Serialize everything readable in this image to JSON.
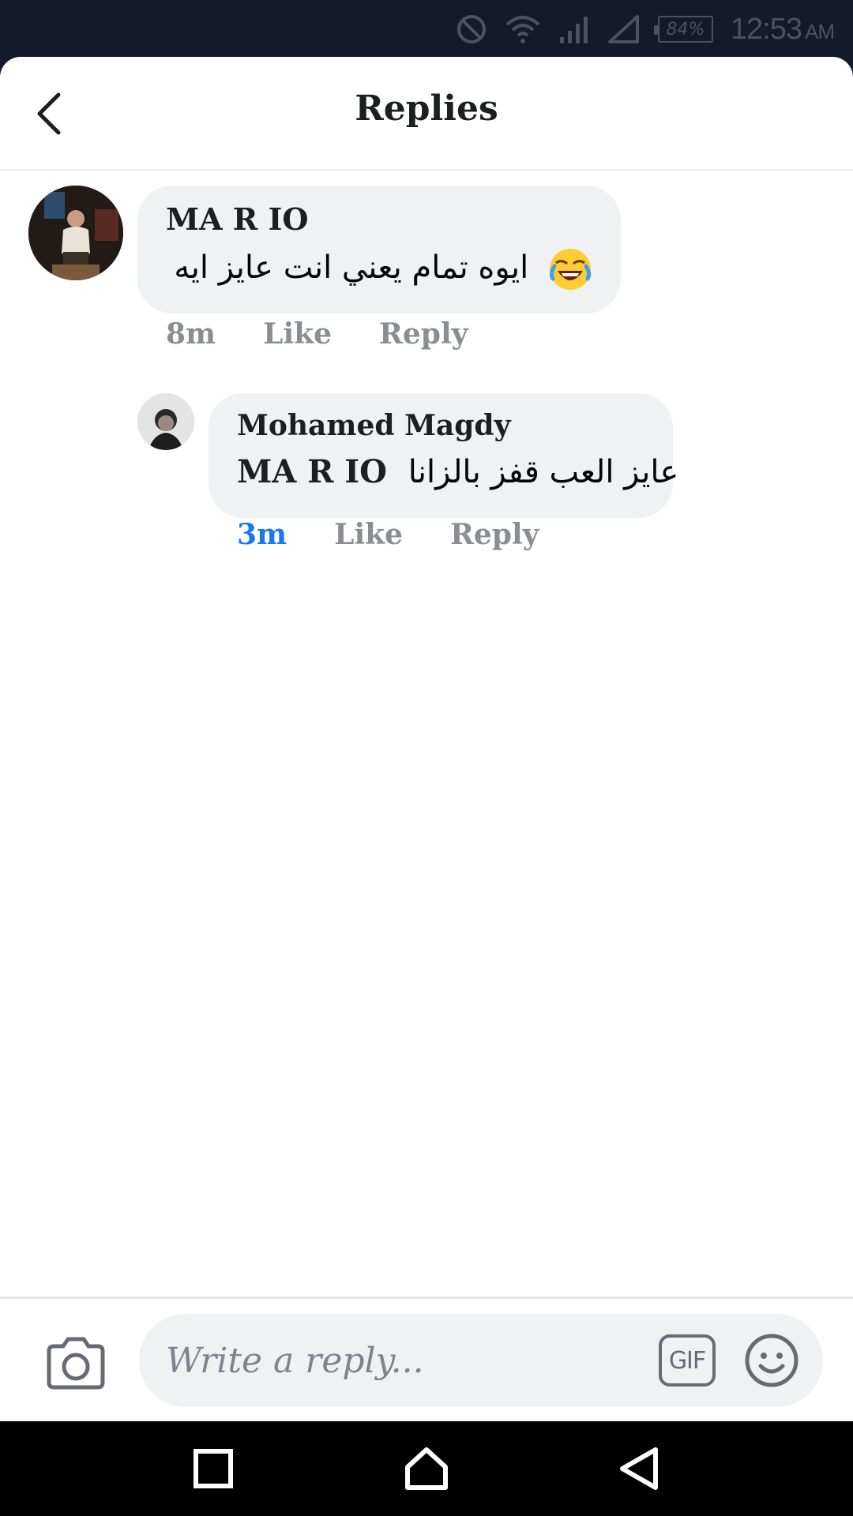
{
  "status_bar": {
    "battery": "84%",
    "time": "12:53",
    "ampm": "AM"
  },
  "header": {
    "title": "Replies"
  },
  "comments": [
    {
      "author": "MA R IO",
      "text": "ايوه تمام يعني انت عايز ايه",
      "emoji": "face-with-tears-of-joy",
      "time": "8m",
      "like": "Like",
      "reply": "Reply"
    },
    {
      "author": "Mohamed Magdy",
      "mention": "MA R IO",
      "text": "عايز العب قفز بالزانا",
      "time": "3m",
      "like": "Like",
      "reply": "Reply"
    }
  ],
  "composer": {
    "placeholder": "Write a reply...",
    "gif_label": "GIF"
  },
  "colors": {
    "accent": "#1877f2",
    "bubble": "#f0f1f3",
    "muted_text": "#8a8d91",
    "status_bar_bg": "#141a2a"
  }
}
